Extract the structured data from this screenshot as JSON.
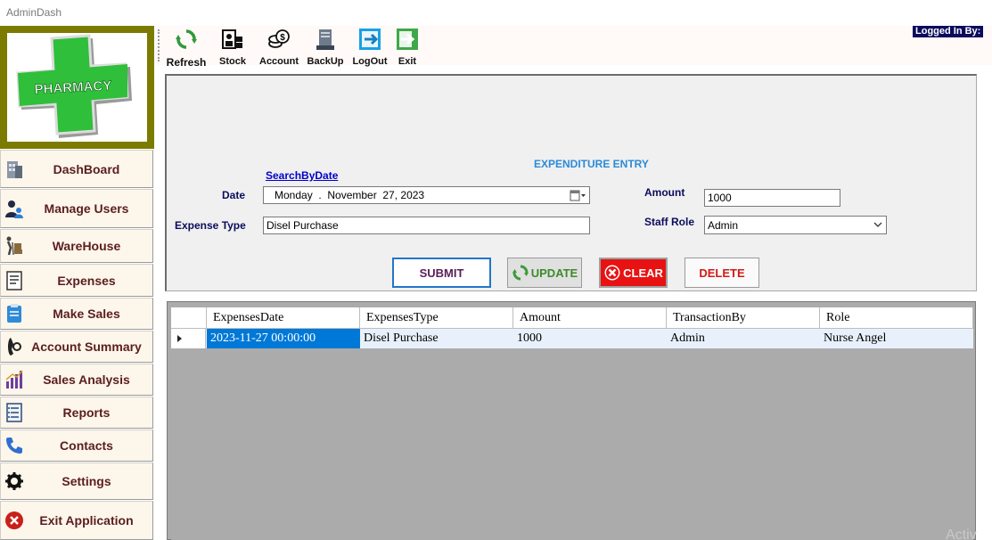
{
  "window": {
    "title": "AdminDash"
  },
  "logo": {
    "text": "PHARMACY"
  },
  "sidebar": {
    "items": [
      {
        "label": "DashBoard",
        "icon": "building-icon"
      },
      {
        "label": "Manage Users",
        "icon": "users-icon"
      },
      {
        "label": "WareHouse",
        "icon": "hand-truck-icon"
      },
      {
        "label": "Expenses",
        "icon": "receipt-icon"
      },
      {
        "label": "Make Sales",
        "icon": "clipboard-icon"
      },
      {
        "label": "Account Summary",
        "icon": "phone-handset-icon"
      },
      {
        "label": "Sales Analysis",
        "icon": "bar-chart-icon"
      },
      {
        "label": "Reports",
        "icon": "report-list-icon"
      },
      {
        "label": "Contacts",
        "icon": "phone-icon"
      },
      {
        "label": "Settings",
        "icon": "gear-icon"
      },
      {
        "label": "Exit Application",
        "icon": "close-circle-icon"
      }
    ]
  },
  "toolbar": {
    "refresh": "Refresh",
    "stock": "Stock",
    "account": "Account",
    "backup": "BackUp",
    "logout": "LogOut",
    "exit": "Exit",
    "logged_in": "Logged In By:"
  },
  "form": {
    "title": "EXPENDITURE ENTRY",
    "search_by_date": "SearchByDate",
    "date_label": "Date",
    "date_value": "Monday  .  November  27, 2023",
    "expense_type_label": "Expense Type",
    "expense_type_value": "Disel Purchase",
    "amount_label": "Amount",
    "amount_value": "1000",
    "staff_role_label": "Staff Role",
    "staff_role_value": "Admin"
  },
  "actions": {
    "submit": "SUBMIT",
    "update": "UPDATE",
    "clear": "CLEAR",
    "delete": "DELETE"
  },
  "grid": {
    "columns": [
      "ExpensesDate",
      "ExpensesType",
      "Amount",
      "TransactionBy",
      "Role"
    ],
    "rows": [
      [
        "2023-11-27 00:00:00",
        "Disel Purchase",
        "1000",
        "Admin",
        "Nurse Angel"
      ]
    ]
  },
  "watermark": "Activ",
  "colors": {
    "title_blue": "#2b8ad8",
    "label_navy": "#0b0b5e",
    "sidebar_text": "#5a1e1e",
    "logo_frame": "#7b7b00",
    "selection": "#0078d7"
  }
}
